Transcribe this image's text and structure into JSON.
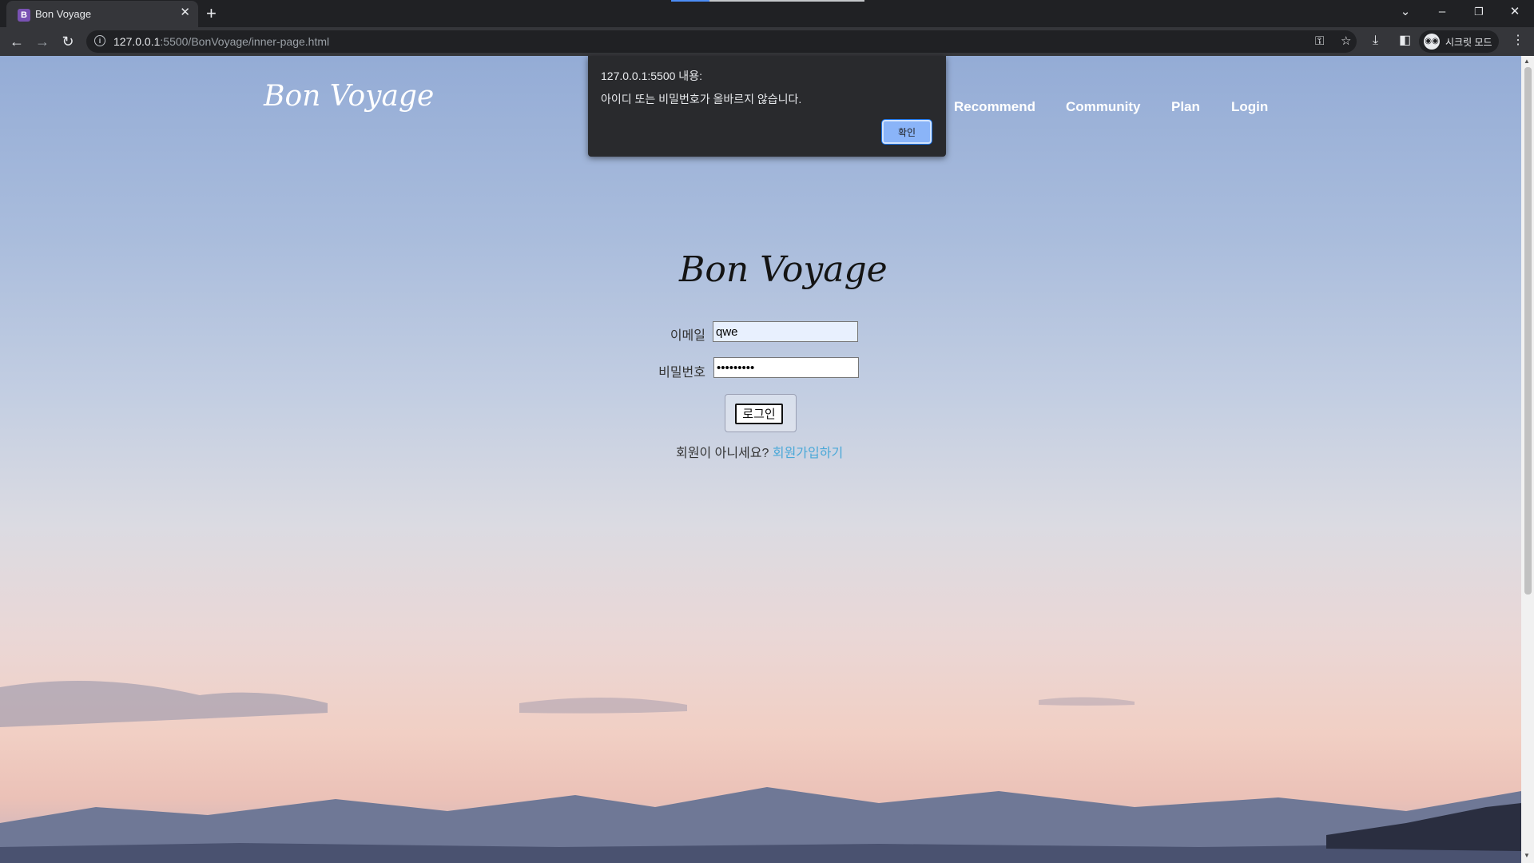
{
  "browser": {
    "tab_title": "Bon Voyage",
    "tab_favicon": "B",
    "tab_close": "✕",
    "new_tab": "+",
    "url_host": "127.0.0.1",
    "url_rest": ":5500/BonVoyage/inner-page.html",
    "incognito_label": "시크릿 모드",
    "icons": [
      "back-icon",
      "forward-icon",
      "reload-icon",
      "info-icon",
      "key-icon",
      "star-icon",
      "download-icon",
      "sidepanel-icon",
      "incognito-icon",
      "menu-icon"
    ]
  },
  "site": {
    "logo": "Bon Voyage",
    "nav": [
      "Recommend",
      "Community",
      "Plan",
      "Login"
    ]
  },
  "login": {
    "logo": "Bon Voyage",
    "email_label": "이메일",
    "email_value": "qwe",
    "password_label": "비밀번호",
    "password_value": "•••••••••",
    "button_label": "로그인",
    "signup_prompt": "회원이 아니세요? ",
    "signup_link": "회원가입하기"
  },
  "alert": {
    "title": "127.0.0.1:5500 내용:",
    "message": "아이디 또는 비밀번호가 올바르지 않습니다.",
    "ok_label": "확인"
  }
}
